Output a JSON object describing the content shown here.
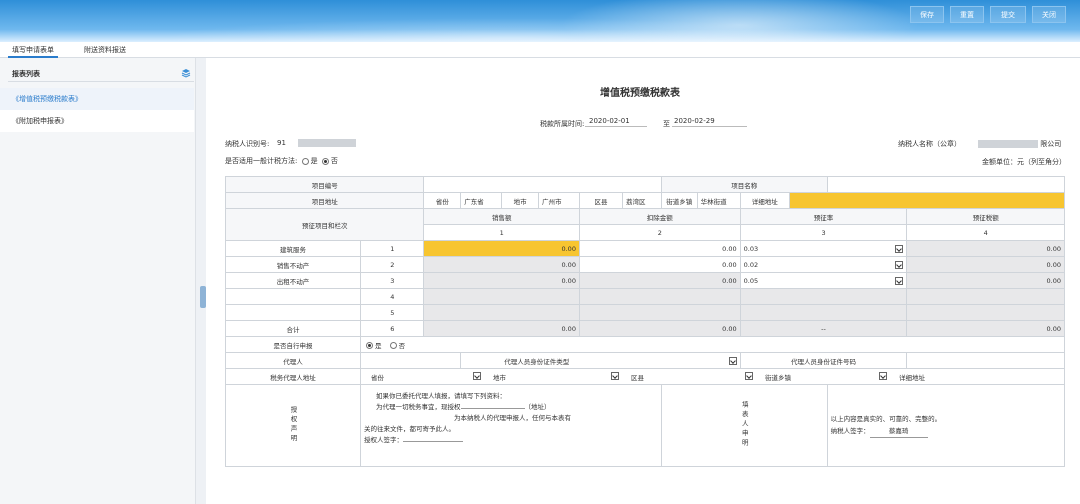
{
  "toolbar": {
    "save": "保存",
    "reset": "重置",
    "submit": "提交",
    "close": "关闭"
  },
  "tabs": [
    "填写申请表单",
    "附送资料报送"
  ],
  "sidebar": {
    "title": "报表列表",
    "items": [
      "《增值税预缴税款表》",
      "《附加税申报表》"
    ]
  },
  "form": {
    "title": "增值税预缴税款表",
    "period_label": "税款所属时间:",
    "period_from": "2020-02-01",
    "period_to_label": "至",
    "period_to": "2020-02-29",
    "taxpayer_id_label": "纳税人识别号:",
    "taxpayer_id_prefix": "91",
    "taxpayer_name_label": "纳税人名称（公章）",
    "taxpayer_name_suffix": "限公司",
    "general_method_label": "是否适用一般计税方法:",
    "opt_yes": "是",
    "opt_no": "否",
    "unit_label": "金额单位：元（列至角分）"
  },
  "table": {
    "project_no": "项目编号",
    "project_name": "项目名称",
    "project_addr": "项目地址",
    "province_label": "省份",
    "province": "广东省",
    "city_label": "地市",
    "city": "广州市",
    "district_label": "区县",
    "district": "荔湾区",
    "street_label": "街道乡镇",
    "street": "华林街道",
    "detail_label": "详细地址",
    "prepay_item": "预征项目和栏次",
    "col_sales": "销售额",
    "col_deduct": "扣除金额",
    "col_rate": "预征率",
    "col_tax": "预征税额",
    "num1": "1",
    "num2": "2",
    "num3": "3",
    "num4": "4",
    "rows": [
      {
        "name": "建筑服务",
        "no": "1",
        "sales": "0.00",
        "deduct": "0.00",
        "rate": "0.03",
        "tax": "0.00"
      },
      {
        "name": "销售不动产",
        "no": "2",
        "sales": "0.00",
        "deduct": "0.00",
        "rate": "0.02",
        "tax": "0.00"
      },
      {
        "name": "出租不动产",
        "no": "3",
        "sales": "0.00",
        "deduct": "0.00",
        "rate": "0.05",
        "tax": "0.00"
      },
      {
        "name": "",
        "no": "4",
        "sales": "",
        "deduct": "",
        "rate": "",
        "tax": ""
      },
      {
        "name": "",
        "no": "5",
        "sales": "",
        "deduct": "",
        "rate": "",
        "tax": ""
      }
    ],
    "total": {
      "name": "合计",
      "no": "6",
      "sales": "0.00",
      "deduct": "0.00",
      "rate": "--",
      "tax": "0.00"
    },
    "self_declare": "是否自行申报",
    "agent": "代理人",
    "agent_id_type": "代理人员身份证件类型",
    "agent_id_no": "代理人员身份证件号码",
    "agent_addr": "税务代理人地址",
    "addr_province": "省份",
    "addr_city": "地市",
    "addr_district": "区县",
    "addr_street": "街道乡镇",
    "addr_detail": "详细地址",
    "auth_label": "授权声明",
    "auth_line1": "如果你已委托代理人填报，请填写下列资料：",
    "auth_line2": "为代理一切税务事宜，现授权",
    "auth_addr": "（地址）",
    "auth_line3": "为本纳税人的代理申报人，任何与本表有",
    "auth_line4": "关的往来文件，都可寄予此人。",
    "auth_sign": "授权人签字：",
    "declarer_label": "填表人申明",
    "decl_line1": "以上内容是真实的、可靠的、完整的。",
    "decl_sign": "纳税人签字：",
    "decl_signer": "蔡嘉琦"
  }
}
